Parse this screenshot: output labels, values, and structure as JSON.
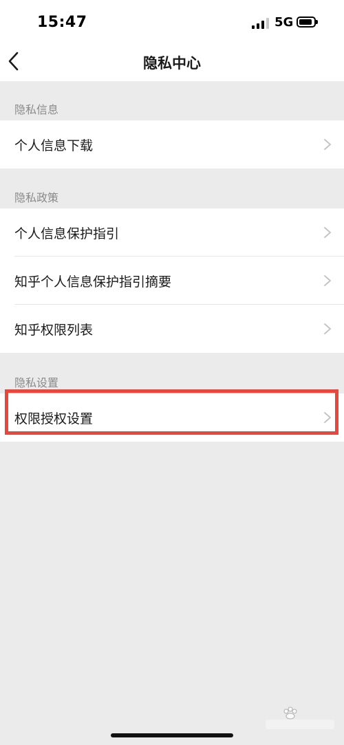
{
  "status_bar": {
    "time": "15:47",
    "network": "5G",
    "signal_icon": "signal-bars-icon",
    "battery_icon": "battery-icon"
  },
  "nav": {
    "title": "隐私中心",
    "back_icon": "chevron-left-icon"
  },
  "sections": [
    {
      "header": "隐私信息",
      "items": [
        {
          "label": "个人信息下载"
        }
      ]
    },
    {
      "header": "隐私政策",
      "items": [
        {
          "label": "个人信息保护指引"
        },
        {
          "label": "知乎个人信息保护指引摘要"
        },
        {
          "label": "知乎权限列表"
        }
      ]
    },
    {
      "header": "隐私设置",
      "items": [
        {
          "label": "权限授权设置"
        }
      ]
    }
  ],
  "colors": {
    "background": "#ebebeb",
    "row": "#ffffff",
    "section_text": "#8a8a8a",
    "highlight": "#e8483b"
  }
}
